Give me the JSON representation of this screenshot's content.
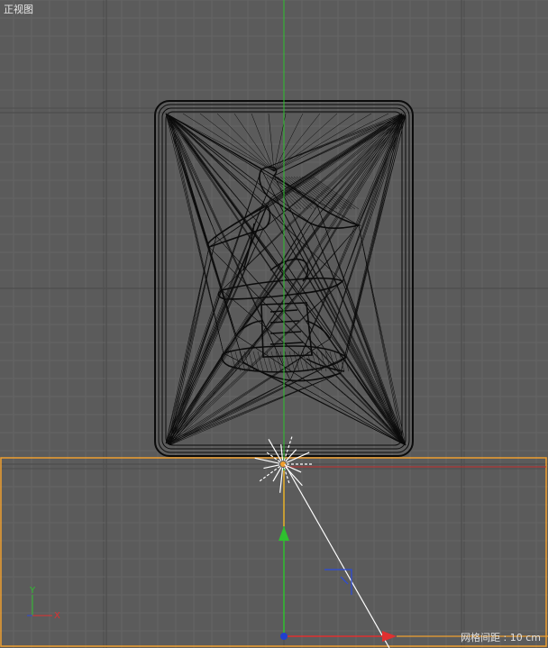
{
  "viewport": {
    "view_name": "正视图",
    "grid_spacing_label": "网格间距 : 10 cm"
  },
  "axis_indicator": {
    "y_label": "Y",
    "x_label": "X"
  },
  "colors": {
    "background": "#5b5b5b",
    "grid_minor": "#646464",
    "grid_major": "#4e4e4e",
    "selection_outline": "#f0a030",
    "y_axis": "#2ec02e",
    "x_axis": "#e03030",
    "mesh_wire": "#0b0b0b"
  },
  "icons": [
    "light-icon",
    "y-axis-handle-icon",
    "x-axis-handle-icon",
    "camera-icon"
  ]
}
